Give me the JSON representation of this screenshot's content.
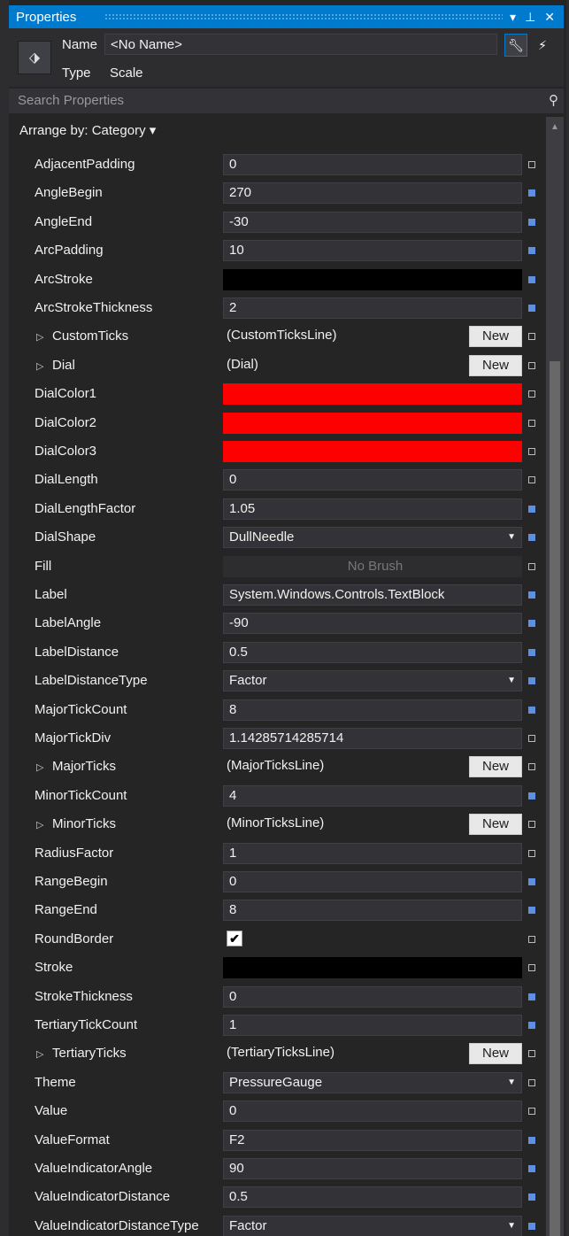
{
  "panel": {
    "title": "Properties"
  },
  "header": {
    "name_label": "Name",
    "name_value": "<No Name>",
    "type_label": "Type",
    "type_value": "Scale"
  },
  "search": {
    "placeholder": "Search Properties"
  },
  "arrange": {
    "label": "Arrange by: Category",
    "caret": "▾"
  },
  "properties": [
    {
      "name": "AdjacentPadding",
      "kind": "text",
      "value": "0",
      "marker": "default"
    },
    {
      "name": "AngleBegin",
      "kind": "text",
      "value": "270",
      "marker": "local"
    },
    {
      "name": "AngleEnd",
      "kind": "text",
      "value": "-30",
      "marker": "local"
    },
    {
      "name": "ArcPadding",
      "kind": "text",
      "value": "10",
      "marker": "local"
    },
    {
      "name": "ArcStroke",
      "kind": "color",
      "value": "",
      "color": "#000000",
      "marker": "local"
    },
    {
      "name": "ArcStrokeThickness",
      "kind": "text",
      "value": "2",
      "marker": "local"
    },
    {
      "name": "CustomTicks",
      "kind": "object",
      "value": "(CustomTicksLine)",
      "button": "New",
      "marker": "default"
    },
    {
      "name": "Dial",
      "kind": "object",
      "value": "(Dial)",
      "button": "New",
      "marker": "default"
    },
    {
      "name": "DialColor1",
      "kind": "color",
      "value": "",
      "color": "#ff0000",
      "marker": "default"
    },
    {
      "name": "DialColor2",
      "kind": "color",
      "value": "",
      "color": "#ff0000",
      "marker": "default"
    },
    {
      "name": "DialColor3",
      "kind": "color",
      "value": "",
      "color": "#ff0000",
      "marker": "default"
    },
    {
      "name": "DialLength",
      "kind": "text",
      "value": "0",
      "marker": "default"
    },
    {
      "name": "DialLengthFactor",
      "kind": "text",
      "value": "1.05",
      "marker": "local"
    },
    {
      "name": "DialShape",
      "kind": "combo",
      "value": "DullNeedle",
      "marker": "local"
    },
    {
      "name": "Fill",
      "kind": "brush",
      "value": "No Brush",
      "marker": "default"
    },
    {
      "name": "Label",
      "kind": "text",
      "value": "System.Windows.Controls.TextBlock",
      "marker": "local"
    },
    {
      "name": "LabelAngle",
      "kind": "text",
      "value": "-90",
      "marker": "local"
    },
    {
      "name": "LabelDistance",
      "kind": "text",
      "value": "0.5",
      "marker": "local"
    },
    {
      "name": "LabelDistanceType",
      "kind": "combo",
      "value": "Factor",
      "marker": "local"
    },
    {
      "name": "MajorTickCount",
      "kind": "text",
      "value": "8",
      "marker": "local"
    },
    {
      "name": "MajorTickDiv",
      "kind": "text",
      "value": "1.14285714285714",
      "marker": "default"
    },
    {
      "name": "MajorTicks",
      "kind": "object",
      "value": "(MajorTicksLine)",
      "button": "New",
      "marker": "default"
    },
    {
      "name": "MinorTickCount",
      "kind": "text",
      "value": "4",
      "marker": "local"
    },
    {
      "name": "MinorTicks",
      "kind": "object",
      "value": "(MinorTicksLine)",
      "button": "New",
      "marker": "default"
    },
    {
      "name": "RadiusFactor",
      "kind": "text",
      "value": "1",
      "marker": "default"
    },
    {
      "name": "RangeBegin",
      "kind": "text",
      "value": "0",
      "marker": "local"
    },
    {
      "name": "RangeEnd",
      "kind": "text",
      "value": "8",
      "marker": "local"
    },
    {
      "name": "RoundBorder",
      "kind": "check",
      "value": "",
      "checked": true,
      "marker": "default"
    },
    {
      "name": "Stroke",
      "kind": "color",
      "value": "",
      "color": "#000000",
      "marker": "default"
    },
    {
      "name": "StrokeThickness",
      "kind": "text",
      "value": "0",
      "marker": "local"
    },
    {
      "name": "TertiaryTickCount",
      "kind": "text",
      "value": "1",
      "marker": "local"
    },
    {
      "name": "TertiaryTicks",
      "kind": "object",
      "value": "(TertiaryTicksLine)",
      "button": "New",
      "marker": "default"
    },
    {
      "name": "Theme",
      "kind": "combo",
      "value": "PressureGauge",
      "marker": "default"
    },
    {
      "name": "Value",
      "kind": "text",
      "value": "0",
      "marker": "default"
    },
    {
      "name": "ValueFormat",
      "kind": "text",
      "value": "F2",
      "marker": "local"
    },
    {
      "name": "ValueIndicatorAngle",
      "kind": "text",
      "value": "90",
      "marker": "local"
    },
    {
      "name": "ValueIndicatorDistance",
      "kind": "text",
      "value": "0.5",
      "marker": "local"
    },
    {
      "name": "ValueIndicatorDistanceType",
      "kind": "combo",
      "value": "Factor",
      "marker": "local"
    }
  ],
  "colors": {
    "accent": "#007acc",
    "local_marker": "#5e8fe0",
    "panel_bg": "#252526",
    "input_bg": "#333337"
  }
}
